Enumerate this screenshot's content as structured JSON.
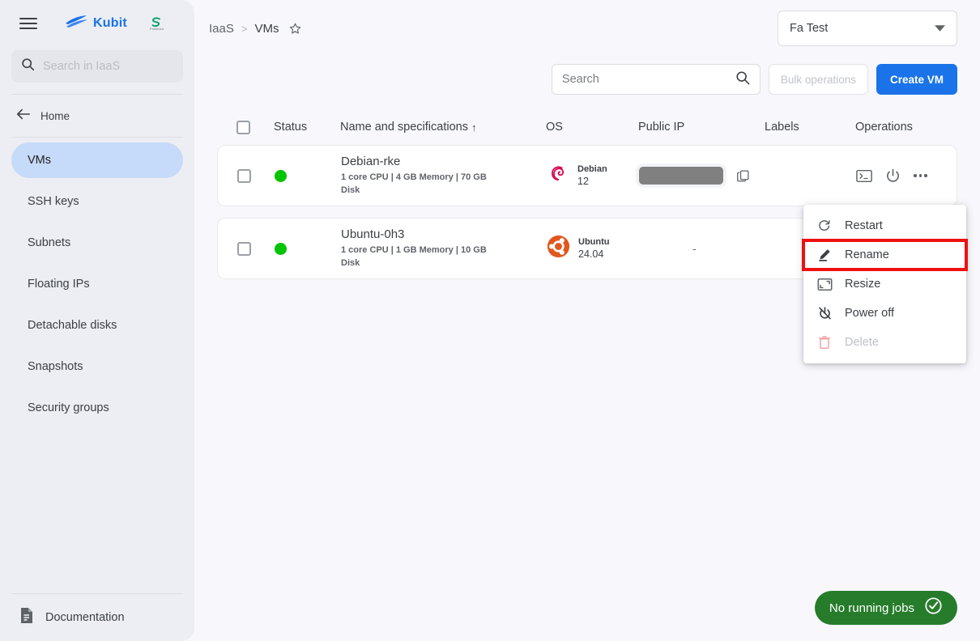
{
  "sidebar": {
    "menu_icon": "hamburger-icon",
    "brand": {
      "name": "Kubit",
      "logo_icon": "kubit-wave-logo",
      "accent": "#1a73e8"
    },
    "secondary_logo": {
      "mark": "S",
      "sub": "Powered"
    },
    "search": {
      "placeholder": "Search in IaaS",
      "icon": "search-icon"
    },
    "home": {
      "label": "Home",
      "icon": "arrow-left-icon"
    },
    "items": [
      {
        "label": "VMs",
        "active": true
      },
      {
        "label": "SSH keys",
        "active": false
      },
      {
        "label": "Subnets",
        "active": false
      },
      {
        "label": "Floating IPs",
        "active": false
      },
      {
        "label": "Detachable disks",
        "active": false
      },
      {
        "label": "Snapshots",
        "active": false
      },
      {
        "label": "Security groups",
        "active": false
      }
    ],
    "active_bg": "#c6daf9",
    "documentation": {
      "label": "Documentation",
      "icon": "document-icon"
    }
  },
  "header": {
    "breadcrumb": {
      "root": "IaaS",
      "separator": ">",
      "current": "VMs",
      "star_icon": "star-outline-icon"
    },
    "project_selector": {
      "value": "Fa Test",
      "chevron": "chevron-down-icon"
    }
  },
  "toolbar": {
    "search": {
      "placeholder": "Search",
      "value": "",
      "icon": "search-icon"
    },
    "bulk_operations_label": "Bulk operations",
    "bulk_operations_disabled": true,
    "create_vm_label": "Create VM",
    "create_vm_color": "#1a73e8"
  },
  "table": {
    "columns": [
      {
        "key": "checkbox",
        "label": ""
      },
      {
        "key": "status",
        "label": "Status"
      },
      {
        "key": "name",
        "label": "Name and specifications"
      },
      {
        "key": "os",
        "label": "OS"
      },
      {
        "key": "public_ip",
        "label": "Public IP"
      },
      {
        "key": "labels",
        "label": "Labels"
      },
      {
        "key": "operations",
        "label": "Operations"
      }
    ],
    "sort_indicator": "↑",
    "sorted_column": "Name and specifications",
    "rows": [
      {
        "checked": false,
        "status": "running",
        "status_color": "#00c400",
        "name": "Debian-rke",
        "specs": "1 core CPU | 4 GB Memory | 70 GB Disk",
        "os_name": "Debian",
        "os_version": "12",
        "os_icon": "debian-logo",
        "public_ip": "",
        "public_ip_masked": true,
        "labels": "",
        "operations": [
          "console-icon",
          "power-icon",
          "more-options-icon"
        ]
      },
      {
        "checked": false,
        "status": "running",
        "status_color": "#00c400",
        "name": "Ubuntu-0h3",
        "specs": "1 core CPU | 1 GB Memory | 10 GB Disk",
        "os_name": "Ubuntu",
        "os_version": "24.04",
        "os_icon": "ubuntu-logo",
        "public_ip": "-",
        "public_ip_masked": false,
        "labels": "",
        "operations": []
      }
    ]
  },
  "context_menu": {
    "highlight_color": "#ee1111",
    "items": [
      {
        "label": "Restart",
        "icon": "restart-icon",
        "disabled": false,
        "highlighted": false
      },
      {
        "label": "Rename",
        "icon": "pencil-icon",
        "disabled": false,
        "highlighted": true
      },
      {
        "label": "Resize",
        "icon": "resize-icon",
        "disabled": false,
        "highlighted": false
      },
      {
        "label": "Power off",
        "icon": "power-off-icon",
        "disabled": false,
        "highlighted": false
      },
      {
        "label": "Delete",
        "icon": "trash-icon",
        "disabled": true,
        "highlighted": false
      }
    ]
  },
  "jobs_status": {
    "label": "No running jobs",
    "icon": "check-circle-icon",
    "color": "#277c2c"
  }
}
